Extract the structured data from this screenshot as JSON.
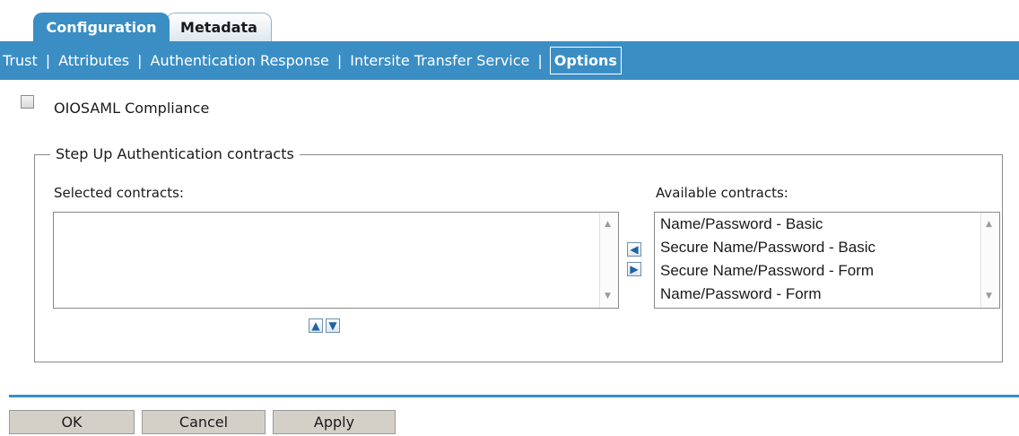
{
  "tabs": [
    {
      "label": "Configuration",
      "active": true
    },
    {
      "label": "Metadata",
      "active": false
    }
  ],
  "subnav": {
    "items": [
      "Trust",
      "Attributes",
      "Authentication Response",
      "Intersite Transfer Service",
      "Options"
    ],
    "selected": "Options"
  },
  "oiosaml": {
    "label": "OIOSAML Compliance",
    "checked": false
  },
  "stepup": {
    "legend": "Step Up Authentication contracts",
    "selected_label": "Selected contracts:",
    "available_label": "Available contracts:",
    "selected_items": [],
    "available_items": [
      "Name/Password - Basic",
      "Secure Name/Password - Basic",
      "Secure Name/Password - Form",
      "Name/Password - Form"
    ]
  },
  "buttons": {
    "ok": "OK",
    "cancel": "Cancel",
    "apply": "Apply"
  },
  "colors": {
    "accent": "#3a8ec4",
    "button_face": "#d4d0c8"
  }
}
